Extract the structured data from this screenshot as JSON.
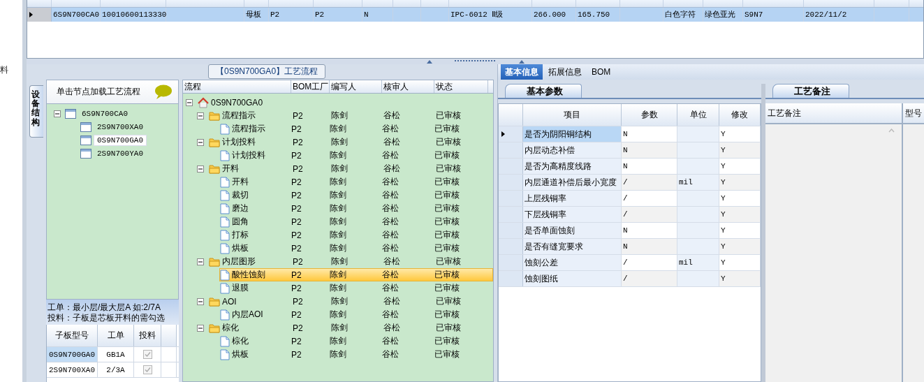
{
  "side_strip": {
    "labels": [
      "料"
    ]
  },
  "top_grid": {
    "rows": [
      {
        "selected": true,
        "cells": [
          "6S9N700CA0",
          "10010600113330",
          null,
          "母板",
          "P2",
          "P2",
          "N",
          null,
          null,
          "IPC-6012 Ⅱ级",
          "266.000",
          "165.750",
          null,
          "白色字符",
          "绿色亚光",
          "S9N7",
          "2022/11/2",
          null
        ]
      }
    ]
  },
  "flow_panel": {
    "title": "【0S9N700GA0】工艺流程",
    "side_tabs": [
      {
        "label": "设备结构",
        "selected": true
      }
    ],
    "structure": {
      "hint": "单击节点加载工艺流程",
      "tree": [
        {
          "label": "6S9N700CA0",
          "expanded": true,
          "selected": false,
          "children": [
            {
              "label": "2S9N700XA0",
              "selected": false
            },
            {
              "label": "0S9N700GA0",
              "selected": true
            },
            {
              "label": "2S9N700YA0",
              "selected": false
            }
          ]
        }
      ],
      "notes": [
        "工单：最小层/最大层A 如:2/7A",
        "投料：子板是芯板开料的需勾选"
      ],
      "subboards": {
        "columns": [
          "子板型号",
          "工单",
          "投料"
        ],
        "rows": [
          {
            "model": "0S9N700GA0",
            "order": "GB1A",
            "feed": true,
            "selected": true
          },
          {
            "model": "2S9N700XA0",
            "order": "2/3A",
            "feed": true,
            "selected": false
          }
        ]
      }
    },
    "process": {
      "columns": [
        "流程",
        "BOM工厂",
        "编写人",
        "核审人",
        "状态"
      ],
      "tree": [
        {
          "kind": "root",
          "label": "0S9N700GA0",
          "expanded": true,
          "selected": false,
          "children": [
            {
              "kind": "folder",
              "label": "流程指示",
              "factory": "P2",
              "writer": "陈剑",
              "reviewer": "谷松",
              "status": "已审核",
              "expanded": true,
              "selected": false,
              "children": [
                {
                  "kind": "doc",
                  "label": "流程指示",
                  "factory": "P2",
                  "writer": "陈剑",
                  "reviewer": "谷松",
                  "status": "已审核",
                  "selected": false
                }
              ]
            },
            {
              "kind": "folder",
              "label": "计划投料",
              "factory": "P2",
              "writer": "陈剑",
              "reviewer": "谷松",
              "status": "已审核",
              "expanded": true,
              "selected": false,
              "children": [
                {
                  "kind": "doc",
                  "label": "计划投料",
                  "factory": "P2",
                  "writer": "陈剑",
                  "reviewer": "谷松",
                  "status": "已审核",
                  "selected": false
                }
              ]
            },
            {
              "kind": "folder",
              "label": "开料",
              "factory": "P2",
              "writer": "陈剑",
              "reviewer": "谷松",
              "status": "已审核",
              "expanded": true,
              "selected": false,
              "children": [
                {
                  "kind": "doc",
                  "label": "开料",
                  "factory": "P2",
                  "writer": "陈剑",
                  "reviewer": "谷松",
                  "status": "已审核",
                  "selected": false
                },
                {
                  "kind": "doc",
                  "label": "裁切",
                  "factory": "P2",
                  "writer": "陈剑",
                  "reviewer": "谷松",
                  "status": "已审核",
                  "selected": false
                },
                {
                  "kind": "doc",
                  "label": "磨边",
                  "factory": "P2",
                  "writer": "陈剑",
                  "reviewer": "谷松",
                  "status": "已审核",
                  "selected": false
                },
                {
                  "kind": "doc",
                  "label": "圆角",
                  "factory": "P2",
                  "writer": "陈剑",
                  "reviewer": "谷松",
                  "status": "已审核",
                  "selected": false
                },
                {
                  "kind": "doc",
                  "label": "打标",
                  "factory": "P2",
                  "writer": "陈剑",
                  "reviewer": "谷松",
                  "status": "已审核",
                  "selected": false
                },
                {
                  "kind": "doc",
                  "label": "烘板",
                  "factory": "P2",
                  "writer": "陈剑",
                  "reviewer": "谷松",
                  "status": "已审核",
                  "selected": false
                }
              ]
            },
            {
              "kind": "folder",
              "label": "内层图形",
              "factory": "P2",
              "writer": "陈剑",
              "reviewer": "谷松",
              "status": "已审核",
              "expanded": true,
              "selected": false,
              "children": [
                {
                  "kind": "doc",
                  "label": "酸性蚀刻",
                  "factory": "P2",
                  "writer": "陈剑",
                  "reviewer": "谷松",
                  "status": "已审核",
                  "selected": true
                },
                {
                  "kind": "doc",
                  "label": "退膜",
                  "factory": "P2",
                  "writer": "陈剑",
                  "reviewer": "谷松",
                  "status": "已审核",
                  "selected": false
                }
              ]
            },
            {
              "kind": "folder",
              "label": "AOI",
              "factory": "P2",
              "writer": "陈剑",
              "reviewer": "谷松",
              "status": "已审核",
              "expanded": true,
              "selected": false,
              "children": [
                {
                  "kind": "doc",
                  "label": "内层AOI",
                  "factory": "P2",
                  "writer": "陈剑",
                  "reviewer": "谷松",
                  "status": "已审核",
                  "selected": false
                }
              ]
            },
            {
              "kind": "folder",
              "label": "棕化",
              "factory": "P2",
              "writer": "陈剑",
              "reviewer": "谷松",
              "status": "已审核",
              "expanded": true,
              "selected": false,
              "children": [
                {
                  "kind": "doc",
                  "label": "棕化",
                  "factory": "P2",
                  "writer": "陈剑",
                  "reviewer": "谷松",
                  "status": "已审核",
                  "selected": false
                },
                {
                  "kind": "doc",
                  "label": "烘板",
                  "factory": "P2",
                  "writer": "陈剑",
                  "reviewer": "谷松",
                  "status": "已审核",
                  "selected": false
                }
              ]
            }
          ]
        }
      ]
    }
  },
  "info_panel": {
    "tabs": [
      {
        "label": "基本信息",
        "selected": true
      },
      {
        "label": "拓展信息",
        "selected": false
      },
      {
        "label": "BOM",
        "selected": false
      }
    ],
    "params": {
      "tab": "基本参数",
      "columns": [
        "项目",
        "参数",
        "单位",
        "修改"
      ],
      "rows": [
        {
          "item": "是否为阴阳铜结构",
          "value": "N",
          "modify": "Y",
          "selected": true
        },
        {
          "item": "内层动态补偿",
          "value": "N",
          "modify": "Y",
          "selected": false
        },
        {
          "item": "是否为高精度线路",
          "value": "N",
          "modify": "Y",
          "selected": false
        },
        {
          "item": "内层通道补偿后最小宽度",
          "value": "/",
          "unit": "mil",
          "modify": "Y",
          "selected": false
        },
        {
          "item": "上层残铜率",
          "value": "/",
          "modify": "Y",
          "selected": false
        },
        {
          "item": "下层残铜率",
          "value": "/",
          "modify": "Y",
          "selected": false
        },
        {
          "item": "是否单面蚀刻",
          "value": "N",
          "modify": "Y",
          "selected": false
        },
        {
          "item": "是否有缝宽要求",
          "value": "N",
          "modify": "Y",
          "selected": false
        },
        {
          "item": "蚀刻公差",
          "value": "/",
          "unit": "mil",
          "modify": "Y",
          "selected": false
        },
        {
          "item": "蚀刻图纸",
          "value": "/",
          "modify": "Y",
          "selected": false
        }
      ]
    },
    "notes": {
      "tab": "工艺备注",
      "columns": [
        "工艺备注",
        "型号"
      ]
    }
  }
}
